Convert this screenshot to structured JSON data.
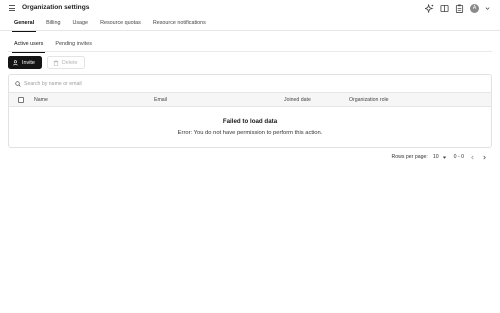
{
  "header": {
    "title": "Organization settings",
    "avatar_initial": "A",
    "icons": [
      "menu-icon",
      "sparkle-icon",
      "book-icon",
      "clipboard-icon",
      "avatar",
      "chevron-down-icon"
    ]
  },
  "tabs": [
    {
      "label": "General",
      "active": true
    },
    {
      "label": "Billing",
      "active": false
    },
    {
      "label": "Usage",
      "active": false
    },
    {
      "label": "Resource quotas",
      "active": false
    },
    {
      "label": "Resource notifications",
      "active": false
    }
  ],
  "subtabs": [
    {
      "label": "Active users",
      "active": true
    },
    {
      "label": "Pending invites",
      "active": false
    }
  ],
  "actions": {
    "invite_label": "Invite",
    "delete_label": "Delete"
  },
  "search": {
    "placeholder": "Search by name or email",
    "value": ""
  },
  "table": {
    "columns": [
      "Name",
      "Email",
      "Joined date",
      "Organization role"
    ],
    "empty_title": "Failed to load data",
    "empty_message": "Error: You do not have permission to perform this action."
  },
  "pagination": {
    "rows_per_page_label": "Rows per page:",
    "rows_per_page_value": "10",
    "range": "0 - 0"
  },
  "colors": {
    "primary_button": "#141414",
    "border": "#e2e2e2",
    "header_bg": "#f6f6f6"
  }
}
